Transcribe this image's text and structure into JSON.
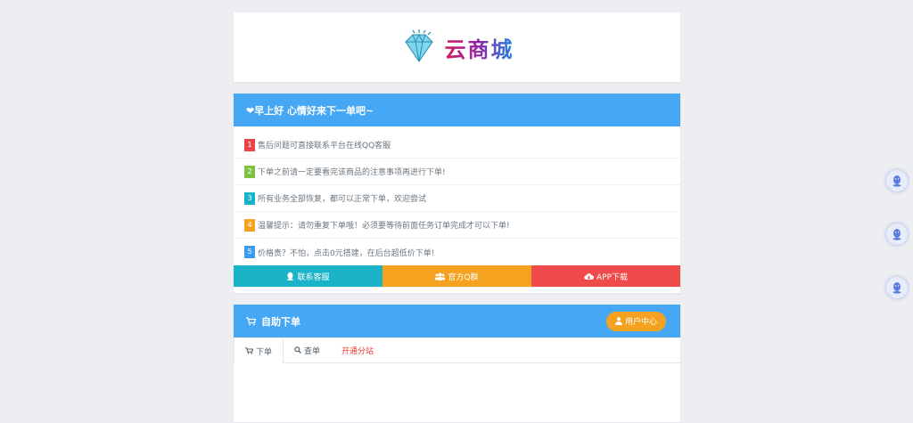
{
  "logo": {
    "text": "云商城"
  },
  "notice": {
    "title": "❤早上好 心情好来下一单吧~",
    "items": [
      {
        "num": "1",
        "color": "#e8454a",
        "text": "售后问题可直接联系平台在线QQ客服"
      },
      {
        "num": "2",
        "color": "#7fc241",
        "text": "下单之前请一定要看完该商品的注意事项再进行下单!"
      },
      {
        "num": "3",
        "color": "#17b3c7",
        "text": "所有业务全部恢复，都可以正常下单，欢迎尝试"
      },
      {
        "num": "4",
        "color": "#f4a21f",
        "text": "温馨提示：请勿重复下单哦！必须要等待前面任务订单完成才可以下单!"
      },
      {
        "num": "5",
        "color": "#3e9bf2",
        "text": "价格贵？不怕，点击0元搭建，在后台超低价下单!"
      }
    ],
    "buttons": [
      {
        "label": "联系客服",
        "icon": "qq-icon",
        "color": "#1bb3c8"
      },
      {
        "label": "官方Q群",
        "icon": "group-icon",
        "color": "#f4a21f"
      },
      {
        "label": "APP下载",
        "icon": "cloud-download-icon",
        "color": "#ef4b4a"
      }
    ]
  },
  "order": {
    "title": "自助下单",
    "user_center": "用户中心",
    "tabs": [
      {
        "label": "下单",
        "icon": "cart-icon"
      },
      {
        "label": "查单",
        "icon": "search-icon"
      },
      {
        "label": "开通分站",
        "icon": ""
      }
    ]
  }
}
